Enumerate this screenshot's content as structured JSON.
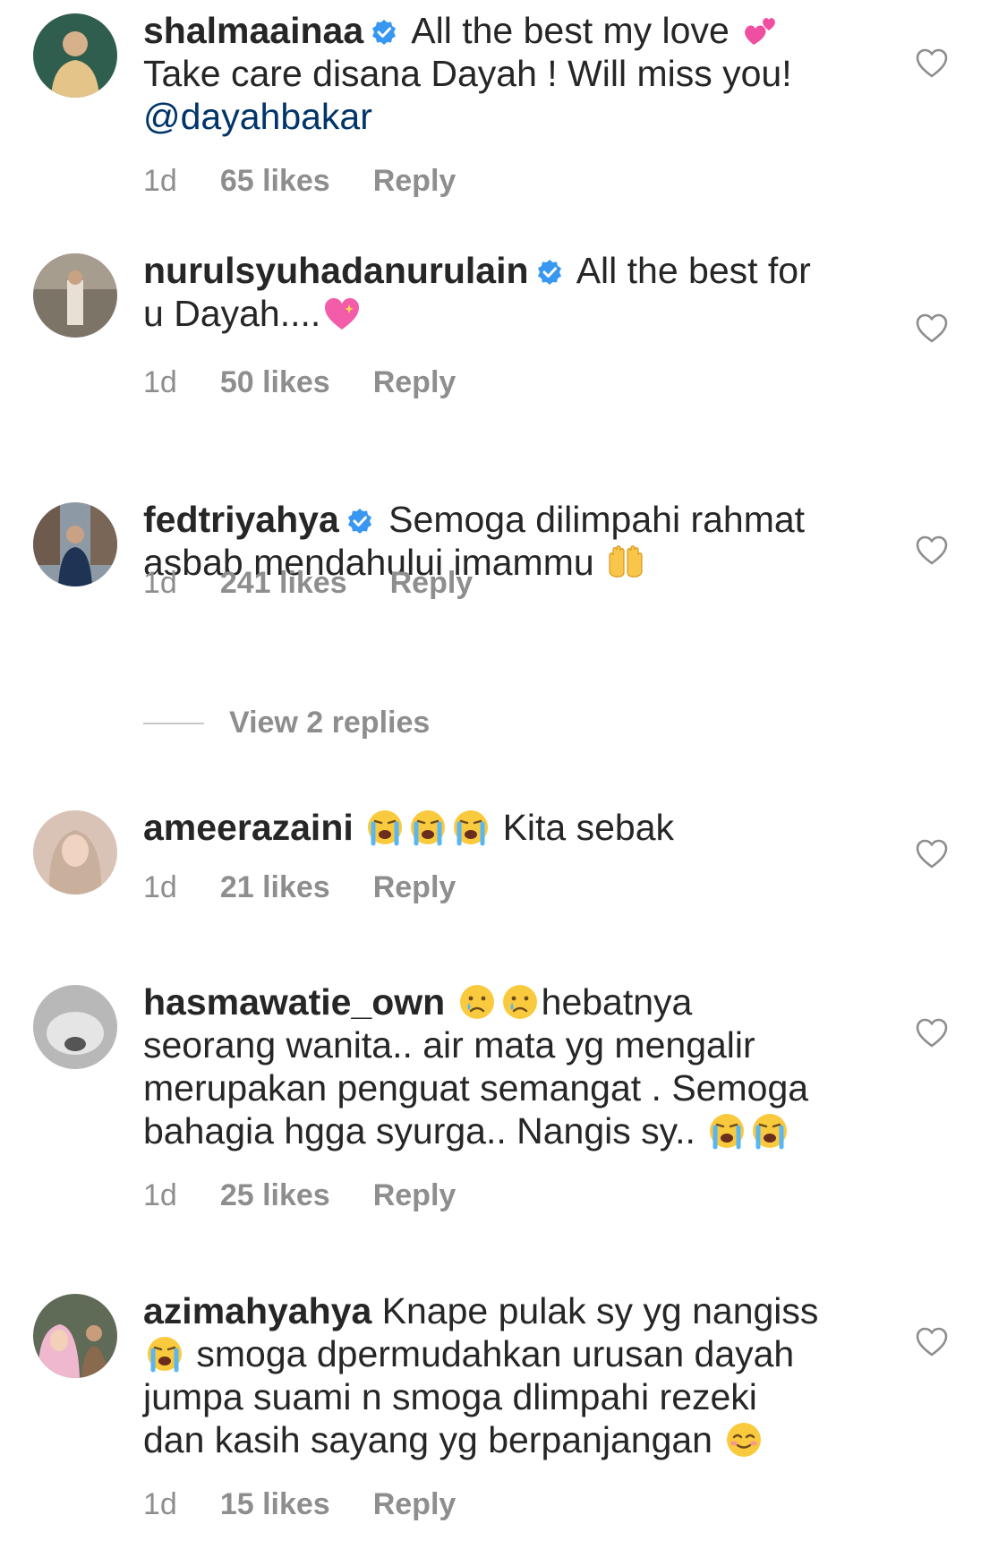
{
  "comments": [
    {
      "username": "shalmaainaa",
      "verified": true,
      "text_1": "All the best my love",
      "text_2": "Take care disana Dayah ! Will miss you!",
      "mention": "@dayahbakar",
      "time": "1d",
      "likes": "65 likes",
      "reply": "Reply",
      "avatar_color": "#c9a56b"
    },
    {
      "username": "nurulsyuhadanurulain",
      "verified": true,
      "text_1": "All the best for",
      "text_2": "u Dayah....",
      "time": "1d",
      "likes": "50 likes",
      "reply": "Reply",
      "avatar_color": "#8a7b72"
    },
    {
      "username": "fedtriyahya",
      "verified": true,
      "text_1": "Semoga dilimpahi rahmat",
      "text_2": "asbab mendahului imammu",
      "time": "1d",
      "likes": "241 likes",
      "reply": "Reply",
      "avatar_color": "#5b6f86"
    },
    {
      "username": "ameerazaini",
      "verified": false,
      "text_1": "Kita sebak",
      "time": "1d",
      "likes": "21 likes",
      "reply": "Reply",
      "avatar_color": "#c7a99a"
    },
    {
      "username": "hasmawatie_own",
      "verified": false,
      "text_1": "hebatnya",
      "text_2": "seorang wanita.. air mata yg mengalir",
      "text_3": "merupakan penguat semangat . Semoga",
      "text_4": "bahagia hgga syurga.. Nangis sy..",
      "time": "1d",
      "likes": "25 likes",
      "reply": "Reply",
      "avatar_color": "#9a9a9a"
    },
    {
      "username": "azimahyahya",
      "verified": false,
      "text_1": "Knape pulak sy yg nangiss",
      "text_2": "smoga dpermudahkan urusan dayah",
      "text_3": "jumpa suami n smoga dlimpahi rezeki",
      "text_4": "dan kasih sayang yg berpanjangan",
      "time": "1d",
      "likes": "15 likes",
      "reply": "Reply",
      "avatar_color": "#6f7d5c"
    }
  ],
  "view_replies": "View 2 replies",
  "colors": {
    "text": "#262626",
    "muted": "#8e8e8e",
    "link": "#003569",
    "verified": "#3897f0"
  },
  "icons": {
    "verified": "verified-badge-icon",
    "heart": "heart-outline-icon",
    "emoji_heart": "two-hearts-emoji",
    "emoji_sparkle_heart": "sparkling-heart-emoji",
    "emoji_raised_hands": "raising-hands-emoji",
    "emoji_crying": "loudly-crying-face-emoji",
    "emoji_sad": "crying-face-emoji",
    "emoji_relieved": "smiling-face-emoji"
  }
}
